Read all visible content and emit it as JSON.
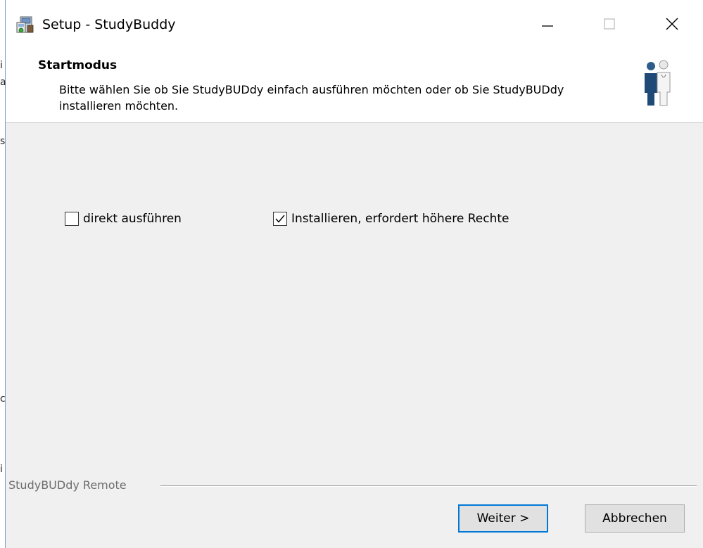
{
  "window": {
    "title": "Setup - StudyBuddy",
    "icon": "setup-installer-icon"
  },
  "header": {
    "title": "Startmodus",
    "description": "Bitte wählen Sie ob Sie StudyBUDdy einfach ausführen möchten oder ob Sie StudyBUDdy installieren möchten.",
    "icon": "people-icon"
  },
  "options": [
    {
      "label": "direkt ausführen",
      "checked": false
    },
    {
      "label": "Installieren, erfordert höhere Rechte",
      "checked": true
    }
  ],
  "group": {
    "label": "StudyBUDdy Remote"
  },
  "buttons": {
    "next_label": "Weiter >",
    "cancel_label": "Abbrechen"
  },
  "background_fragments": [
    "i",
    "a",
    "s",
    "c",
    "i"
  ],
  "colors": {
    "default_button_border": "#0078d7",
    "window_background": "#f0f0f0"
  }
}
